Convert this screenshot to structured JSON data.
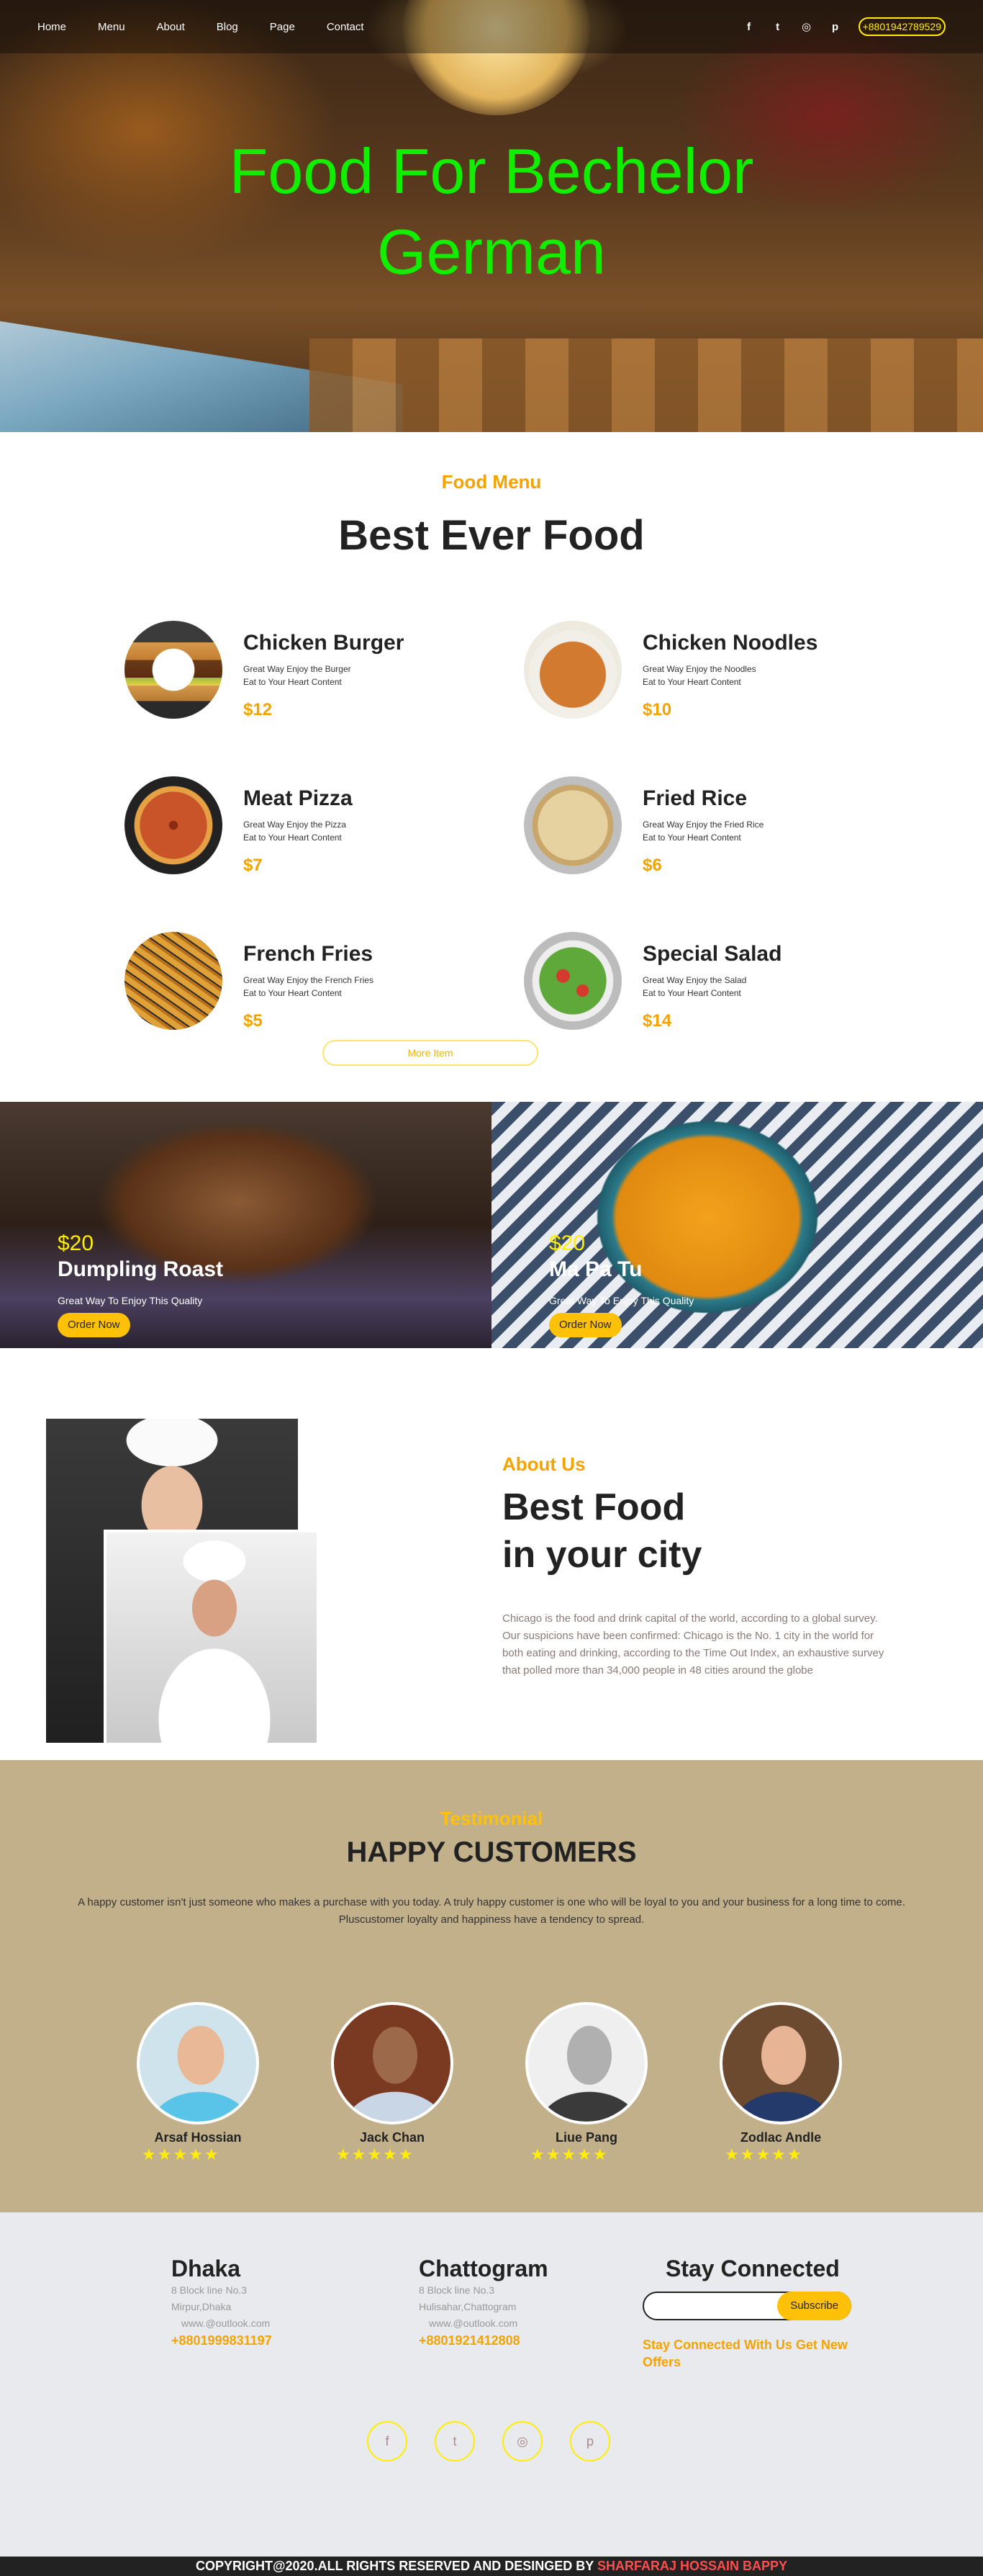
{
  "nav": {
    "links": [
      "Home",
      "Menu",
      "About",
      "Blog",
      "Page",
      "Contact"
    ],
    "social_icons": [
      "facebook-icon",
      "twitter-icon",
      "instagram-icon",
      "pinterest-icon"
    ],
    "social_glyphs": [
      "f",
      "t",
      "◎",
      "p"
    ],
    "phone": "+8801942789529"
  },
  "hero": {
    "title_line1": "Food For Bechelor",
    "title_line2": "German",
    "title_color": "#11ee00"
  },
  "menu": {
    "kicker": "Food Menu",
    "title": "Best Ever Food",
    "items": [
      {
        "name": "Chicken Burger",
        "desc1": "Great Way Enjoy the Burger",
        "desc2": "Eat to Your Heart Content",
        "price": "$12"
      },
      {
        "name": "Chicken Noodles",
        "desc1": "Great Way Enjoy the Noodles",
        "desc2": "Eat to Your Heart Content",
        "price": "$10"
      },
      {
        "name": "Meat Pizza",
        "desc1": "Great Way Enjoy the Pizza",
        "desc2": "Eat to Your Heart Content",
        "price": "$7"
      },
      {
        "name": "Fried Rice",
        "desc1": "Great Way Enjoy the Fried Rice",
        "desc2": "Eat to Your Heart Content",
        "price": "$6"
      },
      {
        "name": "French Fries",
        "desc1": "Great Way Enjoy the French Fries",
        "desc2": "Eat to Your Heart Content",
        "price": "$5"
      },
      {
        "name": "Special Salad",
        "desc1": "Great Way Enjoy the Salad",
        "desc2": "Eat to Your Heart Content",
        "price": "$14"
      }
    ],
    "more_label": "More Item"
  },
  "promos": [
    {
      "price": "$20",
      "name": "Dumpling Roast",
      "sub": "Great Way To Enjoy This Quality",
      "button": "Order Now"
    },
    {
      "price": "$20",
      "name": "Ma Pa Tu",
      "sub": "Great Way To Enjoy This Quality",
      "button": "Order Now"
    }
  ],
  "about": {
    "kicker": "About Us",
    "title_line1": "Best Food",
    "title_line2": "in your city",
    "text": "Chicago is the food and drink capital of the world, according to a global survey. Our suspicions have been confirmed: Chicago is the No. 1 city in the world for both eating and drinking, according to the Time Out Index, an exhaustive survey that polled more than 34,000 people in 48 cities around the globe"
  },
  "testimonial": {
    "kicker": "Testimonial",
    "title": "HAPPY CUSTOMERS",
    "text_line1": "A happy customer isn't just someone who makes a purchase with you today. A truly happy customer is one who will be loyal to you and your business for a long time to come.",
    "text_line2": "Pluscustomer loyalty and happiness have a tendency to spread.",
    "customers": [
      {
        "name": "Arsaf Hossian",
        "stars": "★★★★★",
        "rating": 5
      },
      {
        "name": "Jack Chan",
        "stars": "★★★★★",
        "rating": 5
      },
      {
        "name": "Liue Pang",
        "stars": "★★★★★",
        "rating": 5
      },
      {
        "name": "Zodlac Andle",
        "stars": "★★★★★",
        "rating": 5
      }
    ]
  },
  "footer": {
    "dhaka": {
      "title": "Dhaka",
      "line1": "8 Block line No.3",
      "line2": "Mirpur,Dhaka",
      "line3": "www.@outlook.com",
      "phone": "+8801999831197"
    },
    "chattogram": {
      "title": "Chattogram",
      "line1": "8 Block line No.3",
      "line2": "Hulisahar,Chattogram",
      "line3": "www.@outlook.com",
      "phone": "+8801921412808"
    },
    "stay": {
      "title": "Stay Connected",
      "placeholder": "",
      "button": "Subscribe",
      "note": "Stay Connected With Us Get New Offers"
    },
    "social_icons": [
      "facebook-icon",
      "twitter-icon",
      "instagram-icon",
      "pinterest-icon"
    ],
    "social_glyphs": [
      "f",
      "t",
      "◎",
      "p"
    ]
  },
  "copyright": {
    "text": "COPYRIGHT@2020.ALL RIGHTS RESERVED AND DESINGED BY",
    "author": "SHARFARAJ HOSSAIN BAPPY"
  }
}
